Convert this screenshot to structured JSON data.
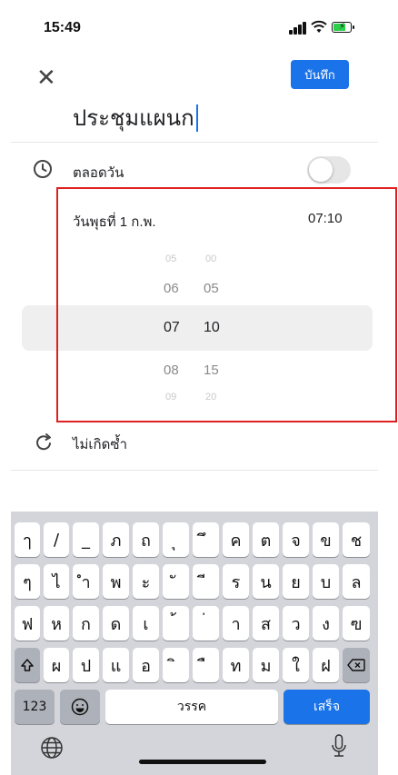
{
  "status": {
    "time": "15:49"
  },
  "header": {
    "save_label": "บันทึก"
  },
  "event": {
    "title": "ประชุมแผนก"
  },
  "allday": {
    "label": "ตลอดวัน"
  },
  "datetime": {
    "date": "วันพุธที่ 1 ก.พ.",
    "time": "07:10"
  },
  "picker": {
    "rows": [
      {
        "hour": "05",
        "minute": "00"
      },
      {
        "hour": "06",
        "minute": "05"
      },
      {
        "hour": "07",
        "minute": "10"
      },
      {
        "hour": "08",
        "minute": "15"
      },
      {
        "hour": "09",
        "minute": "20"
      }
    ],
    "selected_index": 2
  },
  "repeat": {
    "label": "ไม่เกิดซ้ำ"
  },
  "keyboard": {
    "row1": [
      "ๅ",
      "/",
      "_",
      "ภ",
      "ถ",
      "ุ",
      "ึ",
      "ค",
      "ต",
      "จ",
      "ข",
      "ช"
    ],
    "row2": [
      "ๆ",
      "ไ",
      "ำ",
      "พ",
      "ะ",
      "ั",
      "ี",
      "ร",
      "น",
      "ย",
      "บ",
      "ล"
    ],
    "row3": [
      "ฟ",
      "ห",
      "ก",
      "ด",
      "เ",
      "้",
      "่",
      "า",
      "ส",
      "ว",
      "ง",
      "ฃ"
    ],
    "row4": [
      "ผ",
      "ป",
      "แ",
      "อ",
      "ิ",
      "ื",
      "ท",
      "ม",
      "ใ",
      "ฝ"
    ],
    "numbers_label": "123",
    "space_label": "วรรค",
    "done_label": "เสร็จ"
  },
  "colors": {
    "accent": "#1a73e8",
    "highlight_box": "#e02020"
  }
}
